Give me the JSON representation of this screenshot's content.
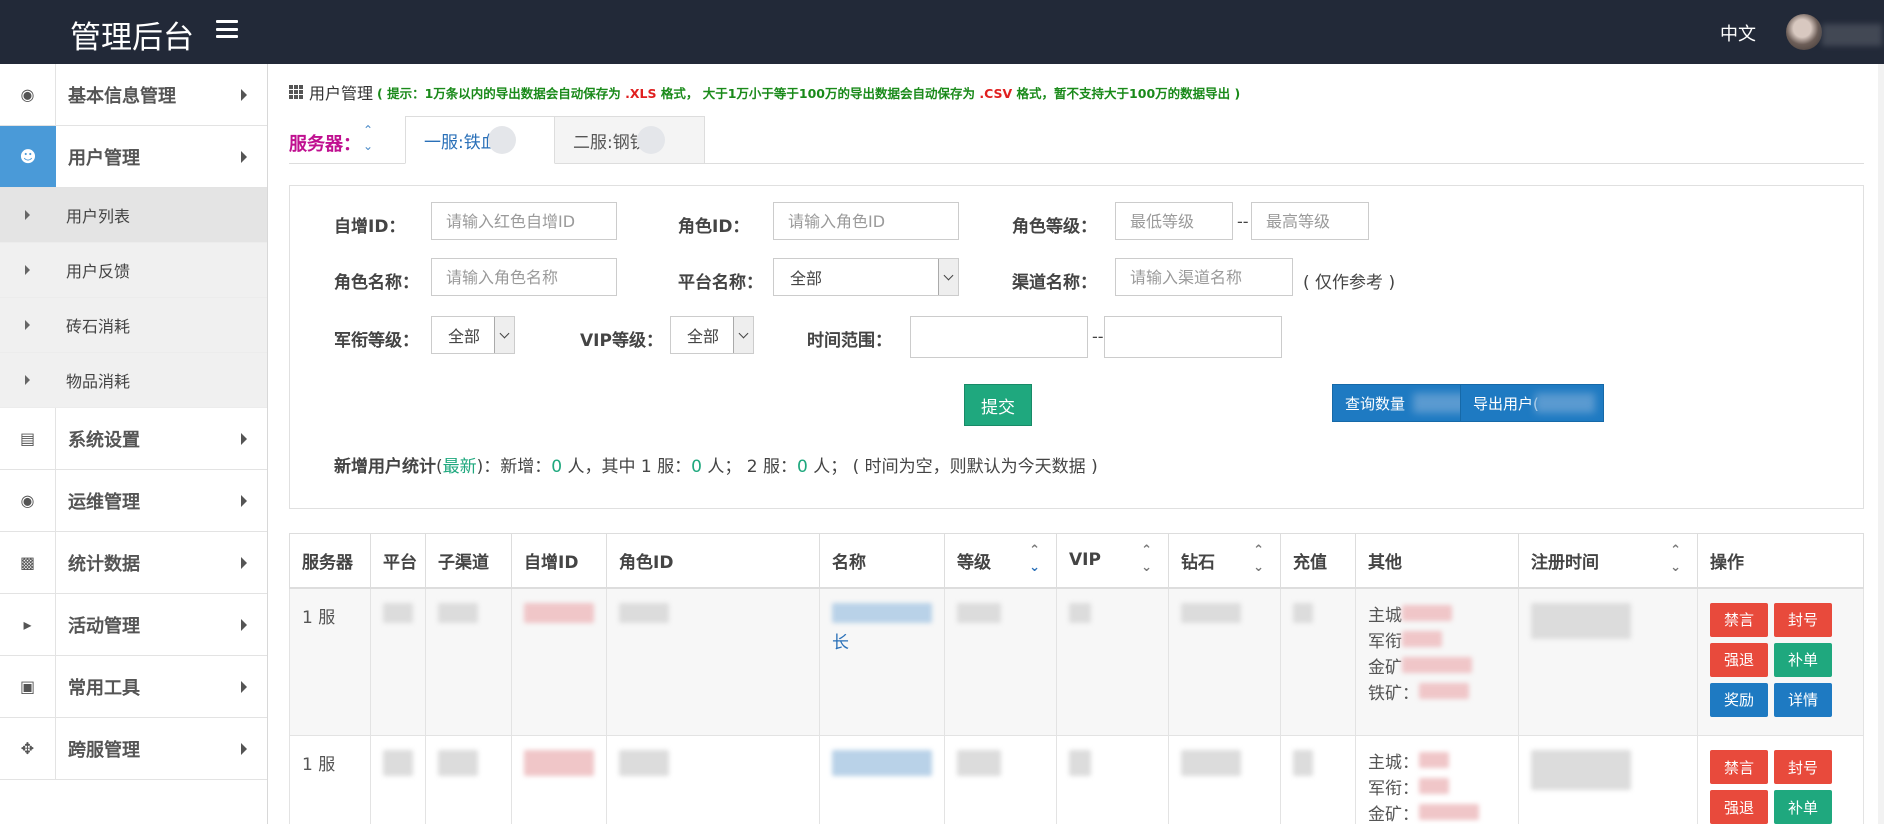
{
  "app": {
    "title": "管理后台",
    "language": "中文"
  },
  "sidebar": {
    "items": [
      {
        "label": "基本信息管理",
        "icon": "dashboard-icon"
      },
      {
        "label": "用户管理",
        "icon": "users-icon"
      },
      {
        "label": "系统设置",
        "icon": "file-icon"
      },
      {
        "label": "运维管理",
        "icon": "dashboard-icon"
      },
      {
        "label": "统计数据",
        "icon": "bar-chart-icon"
      },
      {
        "label": "活动管理",
        "icon": "bullhorn-icon"
      },
      {
        "label": "常用工具",
        "icon": "briefcase-icon"
      },
      {
        "label": "跨服管理",
        "icon": "crosshair-icon"
      }
    ],
    "subitems": [
      "用户列表",
      "用户反馈",
      "砖石消耗",
      "物品消耗"
    ]
  },
  "header": {
    "title": "用户管理",
    "tip_prefix": "( 提示：1万条以内的导出数据会自动保存为 ",
    "tip_xls": ".XLS",
    "tip_mid": " 格式， 大于1万小于等于100万的导出数据会自动保存为 ",
    "tip_csv": ".CSV",
    "tip_suffix": " 格式，暂不支持大于100万的数据导出 )"
  },
  "servers": {
    "label": "服务器：",
    "tabs": [
      "一服:铁血",
      "二服:钢铁"
    ]
  },
  "filters": {
    "auto_id_label": "自增ID：",
    "auto_id_placeholder": "请输入红色自增ID",
    "role_id_label": "角色ID：",
    "role_id_placeholder": "请输入角色ID",
    "role_level_label": "角色等级：",
    "min_level_placeholder": "最低等级",
    "max_level_placeholder": "最高等级",
    "role_name_label": "角色名称：",
    "role_name_placeholder": "请输入角色名称",
    "platform_label": "平台名称：",
    "platform_value": "全部",
    "channel_label": "渠道名称：",
    "channel_placeholder": "请输入渠道名称",
    "channel_note": "( 仅作参考 )",
    "military_label": "军衔等级：",
    "military_value": "全部",
    "vip_label": "VIP等级：",
    "vip_value": "全部",
    "time_label": "时间范围：",
    "dash": "--",
    "submit": "提交",
    "query_count": "查询数量",
    "export_users": "导出用户("
  },
  "stats": {
    "label": "新增用户统计",
    "latest": "最新",
    "text1": "：新增：",
    "new": "0",
    "text2": " 人，其中 1 服：",
    "s1": "0",
    "text3": " 人； 2 服：",
    "s2": "0",
    "text4": " 人； ( 时间为空，则默认为今天数据 )"
  },
  "table": {
    "columns": [
      "服务器",
      "平台",
      "子渠道",
      "自增ID",
      "角色ID",
      "名称",
      "等级",
      "VIP",
      "钻石",
      "充值",
      "其他",
      "注册时间",
      "操作"
    ],
    "rows": [
      {
        "server": "1 服",
        "name_tail": "长",
        "other": [
          "主城",
          "军衔",
          "金矿",
          "铁矿："
        ]
      },
      {
        "server": "1 服",
        "name_tail": "",
        "other": [
          "主城：",
          "军衔：",
          "金矿："
        ]
      }
    ],
    "ops": [
      "禁言",
      "封号",
      "强退",
      "补单",
      "奖励",
      "详情"
    ]
  },
  "colors": {
    "topbar": "#222938",
    "active": "#4a9ad8",
    "green": "#1fa87e",
    "red": "#e84a3c",
    "blue": "#1e7ac2"
  }
}
